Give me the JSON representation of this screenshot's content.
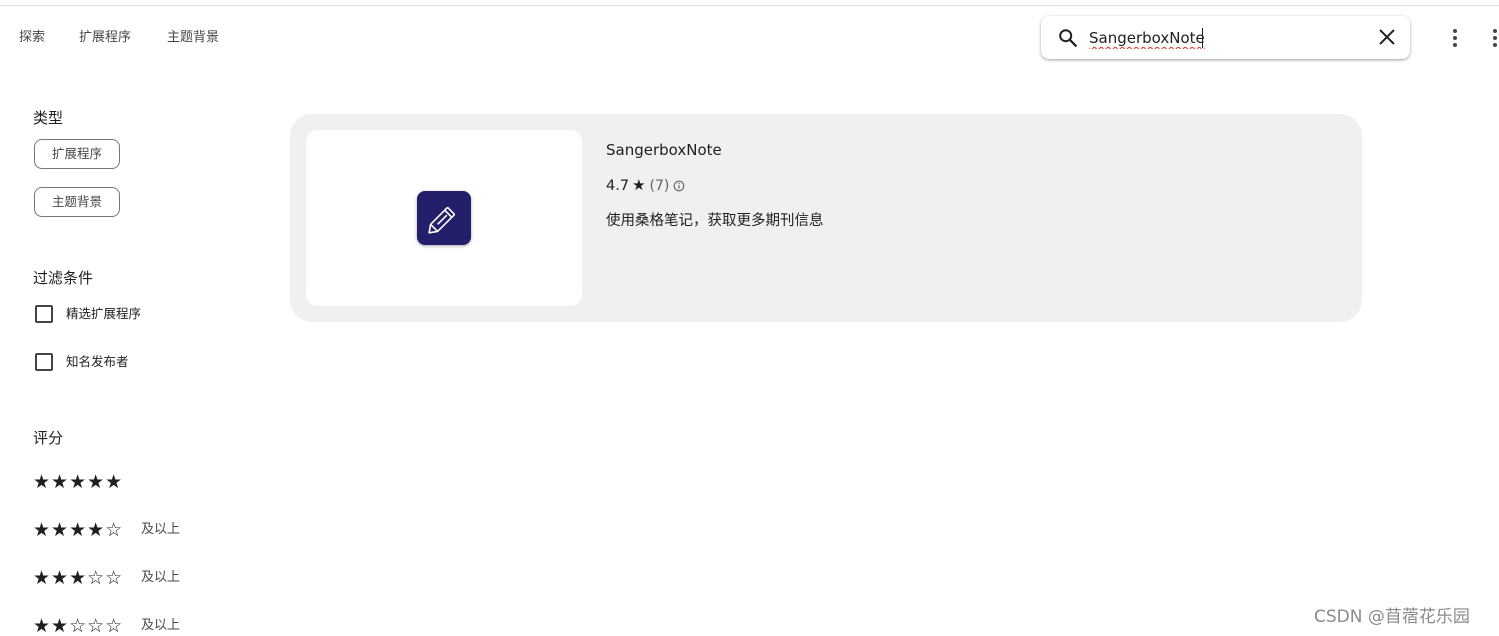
{
  "nav": {
    "items": [
      "探索",
      "扩展程序",
      "主题背景"
    ]
  },
  "search": {
    "value": "SangerboxNote",
    "icon": "search-icon",
    "clear_icon": "close-icon"
  },
  "menu": {
    "icon": "more-vert-icon"
  },
  "sidebar": {
    "type_title": "类型",
    "type_chips": [
      "扩展程序",
      "主题背景"
    ],
    "filter_title": "过滤条件",
    "filters": [
      {
        "label": "精选扩展程序",
        "checked": false
      },
      {
        "label": "知名发布者",
        "checked": false
      }
    ],
    "rating_title": "评分",
    "ratings": [
      {
        "stars": "★★★★★",
        "suffix": "",
        "level": 5
      },
      {
        "stars": "★★★★☆",
        "suffix": "及以上",
        "level": 4
      },
      {
        "stars": "★★★☆☆",
        "suffix": "及以上",
        "level": 3
      },
      {
        "stars": "★★☆☆☆",
        "suffix": "及以上",
        "level": 2
      }
    ]
  },
  "result": {
    "title": "SangerboxNote",
    "rating": "4.7",
    "rating_star": "★",
    "review_count": "(7)",
    "description": "使用桑格笔记，获取更多期刊信息",
    "icon": "pen-icon",
    "icon_color": "#241f6b"
  },
  "watermark": "CSDN @苜蓿花乐园",
  "colors": {
    "card_bg": "#eff1ee",
    "text": "#1f1f1f",
    "muted": "#444746"
  }
}
